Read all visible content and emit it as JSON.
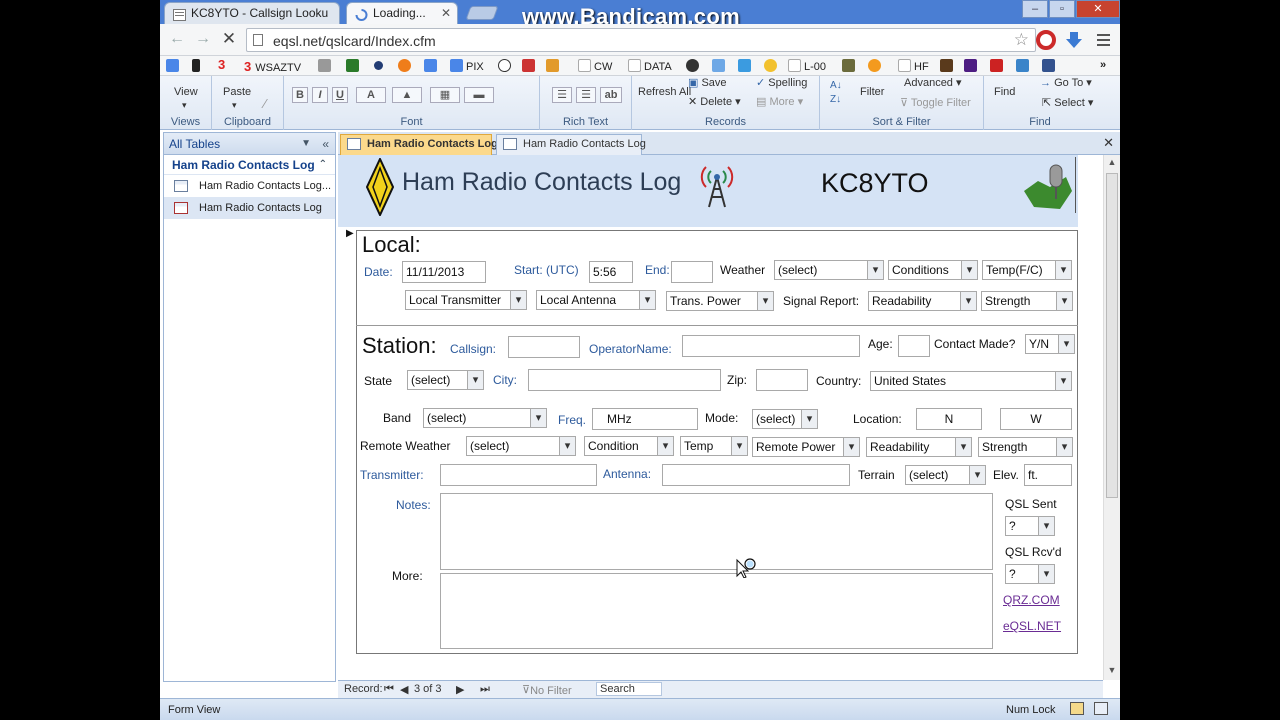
{
  "overlay": {
    "watermark": "www.Bandicam.com"
  },
  "browser": {
    "tabs": [
      {
        "label": "KC8YTO - Callsign Looku",
        "state": "inactive"
      },
      {
        "label": "Loading...",
        "state": "active"
      }
    ],
    "url": "eqsl.net/qslcard/Index.cfm",
    "bookmarks": [
      "WSAZTV",
      "PIX",
      "CW",
      "DATA",
      "L-00",
      "HF"
    ],
    "window_buttons": {
      "minimize": "–",
      "maximize": "▫",
      "close": "✕"
    }
  },
  "ribbon": {
    "groups": [
      {
        "name": "Views",
        "items": [
          "View"
        ]
      },
      {
        "name": "Clipboard",
        "items": [
          "Paste"
        ]
      },
      {
        "name": "Font",
        "items": []
      },
      {
        "name": "Rich Text",
        "items": []
      },
      {
        "name": "Records",
        "items": [
          "Refresh All",
          "Save",
          "Spelling",
          "Delete",
          "More"
        ]
      },
      {
        "name": "Sort & Filter",
        "items": [
          "Filter",
          "Advanced",
          "Toggle Filter"
        ]
      },
      {
        "name": "Find",
        "items": [
          "Find",
          "Go To",
          "Select"
        ]
      }
    ]
  },
  "nav_pane": {
    "header": "All Tables",
    "group": "Ham Radio Contacts Log",
    "items": [
      {
        "label": "Ham Radio Contacts Log...",
        "selected": false
      },
      {
        "label": "Ham Radio Contacts Log",
        "selected": true
      }
    ]
  },
  "doc_tabs": [
    {
      "label": "Ham Radio Contacts Log",
      "active": true
    },
    {
      "label": "Ham Radio Contacts Log",
      "active": false
    }
  ],
  "form": {
    "title": "Ham Radio Contacts Log",
    "callsign_header": "KC8YTO",
    "local": {
      "heading": "Local:",
      "date_label": "Date:",
      "date": "11/11/2013",
      "start_label": "Start: (UTC)",
      "start": "5:56",
      "end_label": "End:",
      "end": "",
      "weather_label": "Weather",
      "weather": "(select)",
      "conditions": "Conditions",
      "temp": "Temp(F/C)",
      "transmitter": "Local Transmitter",
      "antenna": "Local Antenna",
      "power": "Trans. Power",
      "signal_label": "Signal Report:",
      "readability": "Readability",
      "strength": "Strength"
    },
    "station": {
      "heading": "Station:",
      "callsign_label": "Callsign:",
      "callsign": "",
      "operator_label": "OperatorName:",
      "operator": "",
      "age_label": "Age:",
      "age": "",
      "contact_label": "Contact Made?",
      "contact": "Y/N",
      "state_label": "State",
      "state": "(select)",
      "city_label": "City:",
      "city": "",
      "zip_label": "Zip:",
      "zip": "",
      "country_label": "Country:",
      "country": "United States",
      "band_label": "Band",
      "band": "(select)",
      "freq_label": "Freq.",
      "freq": "MHz",
      "mode_label": "Mode:",
      "mode": "(select)",
      "location_label": "Location:",
      "lat": "N",
      "lon": "W",
      "remote_weather_label": "Remote Weather",
      "remote_weather": "(select)",
      "condition": "Condition",
      "temp": "Temp",
      "remote_power": "Remote Power",
      "readability": "Readability",
      "strength": "Strength",
      "transmitter_label": "Transmitter:",
      "antenna_label": "Antenna:",
      "terrain_label": "Terrain",
      "terrain": "(select)",
      "elev_label": "Elev.",
      "elev": "ft.",
      "notes_label": "Notes:",
      "more_label": "More:",
      "qsl_sent_label": "QSL Sent",
      "qsl_sent": "?",
      "qsl_rcvd_label": "QSL Rcv'd",
      "qsl_rcvd": "?",
      "link_qrz": "QRZ.COM",
      "link_eqsl": "eQSL.NET"
    }
  },
  "record_nav": {
    "label": "Record:",
    "position": "3 of 3",
    "filter": "No Filter",
    "search": "Search"
  },
  "status": {
    "view": "Form View",
    "numlock": "Num Lock"
  },
  "colors": {
    "chrome_blue": "#4a7ed3",
    "ribbon_bg": "#dfe8f4",
    "active_doc_tab": "#fbd98c",
    "header_band": "#d5e3f5",
    "link": "#6a2c94"
  }
}
